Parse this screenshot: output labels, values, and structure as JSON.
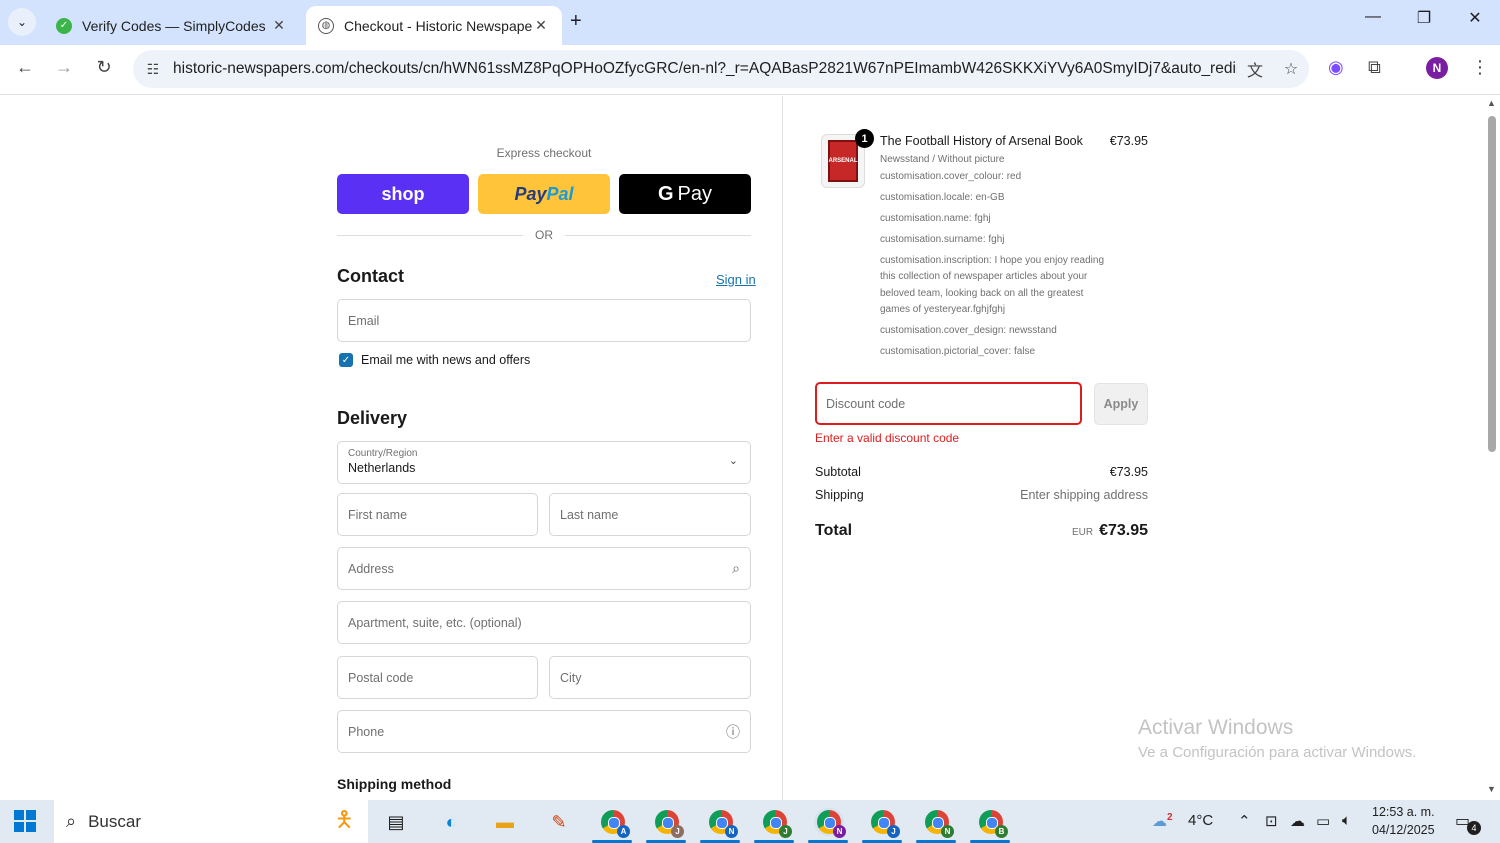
{
  "browser": {
    "tabs": [
      {
        "title": "Verify Codes — SimplyCodes",
        "active": false
      },
      {
        "title": "Checkout - Historic Newspapers",
        "active": true
      }
    ],
    "url": "historic-newspapers.com/checkouts/cn/hWN61ssMZ8PqOPHoOZfycGRC/en-nl?_r=AQABasP2821W67nPEImambW426SKKXiYVy6A0SmyIDj7&auto_redire...",
    "profile_initial": "N"
  },
  "checkout": {
    "express_label": "Express checkout",
    "shop_label": "shop",
    "paypal_label_a": "Pay",
    "paypal_label_b": "Pal",
    "gpay_g": "G",
    "gpay_label": "Pay",
    "or_label": "OR",
    "contact": {
      "heading": "Contact",
      "signin": "Sign in",
      "email_placeholder": "Email",
      "newsletter_label": "Email me with news and offers"
    },
    "delivery": {
      "heading": "Delivery",
      "country_label": "Country/Region",
      "country_value": "Netherlands",
      "first_name": "First name",
      "last_name": "Last name",
      "address": "Address",
      "apartment": "Apartment, suite, etc. (optional)",
      "postal_code": "Postal code",
      "city": "City",
      "phone": "Phone"
    },
    "shipping_method_heading": "Shipping method"
  },
  "summary": {
    "product": {
      "qty": "1",
      "name": "The Football History of Arsenal Book",
      "price": "€73.95",
      "thumb_text": "ARSENAL",
      "lines": [
        "Newsstand / Without picture",
        "customisation.cover_colour: red",
        "customisation.locale: en-GB",
        "customisation.name: fghj",
        "customisation.surname: fghj",
        "customisation.inscription: I hope you enjoy reading this collection of newspaper articles about your beloved team, looking back on all the greatest games of yesteryear.fghjfghj",
        "customisation.cover_design: newsstand",
        "customisation.pictorial_cover: false"
      ]
    },
    "discount_placeholder": "Discount code",
    "apply_label": "Apply",
    "discount_error": "Enter a valid discount code",
    "subtotal_label": "Subtotal",
    "subtotal_value": "€73.95",
    "shipping_label": "Shipping",
    "shipping_value": "Enter shipping address",
    "total_label": "Total",
    "total_currency": "EUR",
    "total_value": "€73.95"
  },
  "watermark": {
    "line1": "Activar Windows",
    "line2": "Ve a Configuración para activar Windows."
  },
  "taskbar": {
    "search_label": "Buscar",
    "weather_badge": "2",
    "temperature": "4°C",
    "time": "12:53 a. m.",
    "date": "04/12/2025",
    "notifications": "4",
    "chrome_profiles": [
      "A",
      "J",
      "N",
      "J",
      "N",
      "J",
      "N",
      "B"
    ]
  }
}
